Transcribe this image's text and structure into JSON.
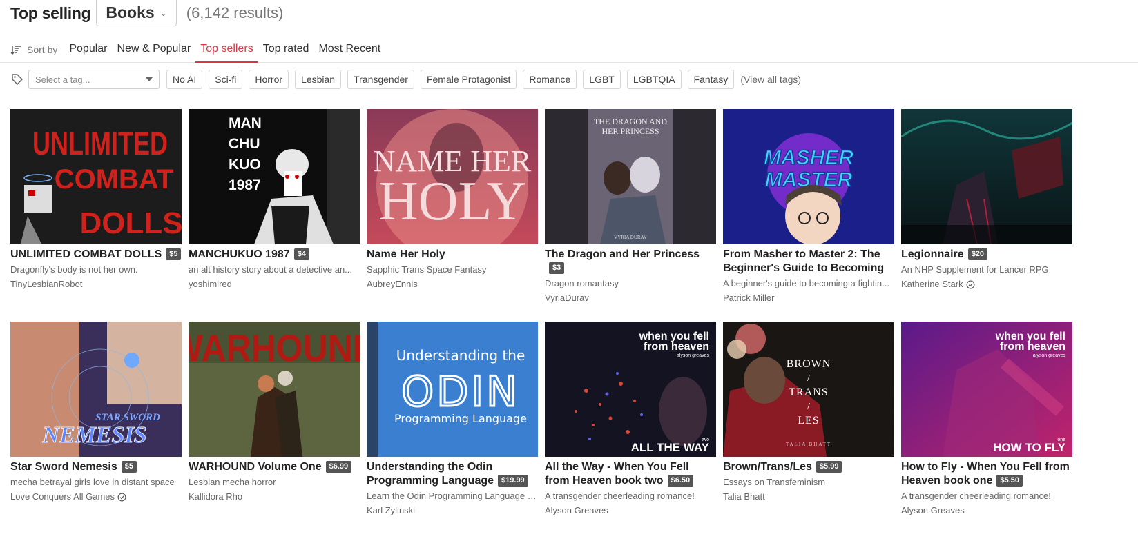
{
  "header": {
    "title": "Top selling",
    "category": "Books",
    "results": "(6,142 results)"
  },
  "sort": {
    "label": "Sort by",
    "tabs": [
      "Popular",
      "New & Popular",
      "Top sellers",
      "Top rated",
      "Most Recent"
    ],
    "active": "Top sellers"
  },
  "tags": {
    "placeholder": "Select a tag...",
    "items": [
      "No AI",
      "Sci-fi",
      "Horror",
      "Lesbian",
      "Transgender",
      "Female Protagonist",
      "Romance",
      "LGBT",
      "LGBTQIA",
      "Fantasy"
    ],
    "view_all": "View all tags"
  },
  "books": [
    {
      "title": "UNLIMITED COMBAT DOLLS",
      "price": "$5",
      "desc": "Dragonfly's body is not her own.",
      "author": "TinyLesbianRobot",
      "verified": false,
      "cover_text": "UNLIMITED COMBAT DOLLS"
    },
    {
      "title": "MANCHUKUO 1987",
      "price": "$4",
      "desc": "an alt history story about a detective an...",
      "author": "yoshimired",
      "verified": false,
      "cover_text": "MAN CHU KUO 1987"
    },
    {
      "title": "Name Her Holy",
      "price": "",
      "desc": "Sapphic Trans Space Fantasy",
      "author": "AubreyEnnis",
      "verified": false,
      "cover_text": "NAME HER HOLY"
    },
    {
      "title": "The Dragon and Her Princess",
      "price": "$3",
      "desc": "Dragon romantasy",
      "author": "VyriaDurav",
      "verified": false,
      "cover_text": "THE DRAGON AND HER PRINCESS"
    },
    {
      "title": "From Masher to Master 2: The Beginner's Guide to Becoming a...",
      "price": "",
      "desc": "A beginner's guide to becoming a fightin...",
      "author": "Patrick Miller",
      "verified": false,
      "cover_text": "FROM MASHER TO MASTER"
    },
    {
      "title": "Legionnaire",
      "price": "$20",
      "desc": "An NHP Supplement for Lancer RPG",
      "author": "Katherine Stark",
      "verified": true,
      "cover_text": ""
    },
    {
      "title": "Star Sword Nemesis",
      "price": "$5",
      "desc": "mecha betrayal girls love in distant space",
      "author": "Love Conquers All Games",
      "verified": true,
      "cover_text": "STAR SWORD NEMESIS"
    },
    {
      "title": "WARHOUND Volume One",
      "price": "$6.99",
      "desc": "Lesbian mecha horror",
      "author": "Kallidora Rho",
      "verified": false,
      "cover_text": "WARHOUND"
    },
    {
      "title": "Understanding the Odin Programming Language",
      "price": "$19.99",
      "desc": "Learn the Odin Programming Language a...",
      "author": "Karl Zylinski",
      "verified": false,
      "cover_text": "Understanding the ODIN Programming Language"
    },
    {
      "title": "All the Way - When You Fell from Heaven book two",
      "price": "$6.50",
      "desc": "A transgender cheerleading romance!",
      "author": "Alyson Greaves",
      "verified": false,
      "cover_text": "when you fell from heaven alyson greaves two ALL THE WAY"
    },
    {
      "title": "Brown/Trans/Les",
      "price": "$5.99",
      "desc": "Essays on Transfeminism",
      "author": "Talia Bhatt",
      "verified": false,
      "cover_text": "BROWN / TRANS / LES TALIA BHATT"
    },
    {
      "title": "How to Fly - When You Fell from Heaven book one",
      "price": "$5.50",
      "desc": "A transgender cheerleading romance!",
      "author": "Alyson Greaves",
      "verified": false,
      "cover_text": "when you fell from heaven alyson greaves one HOW TO FLY"
    }
  ],
  "colors": {
    "accent": "#dc3545",
    "price_badge": "#555555"
  }
}
